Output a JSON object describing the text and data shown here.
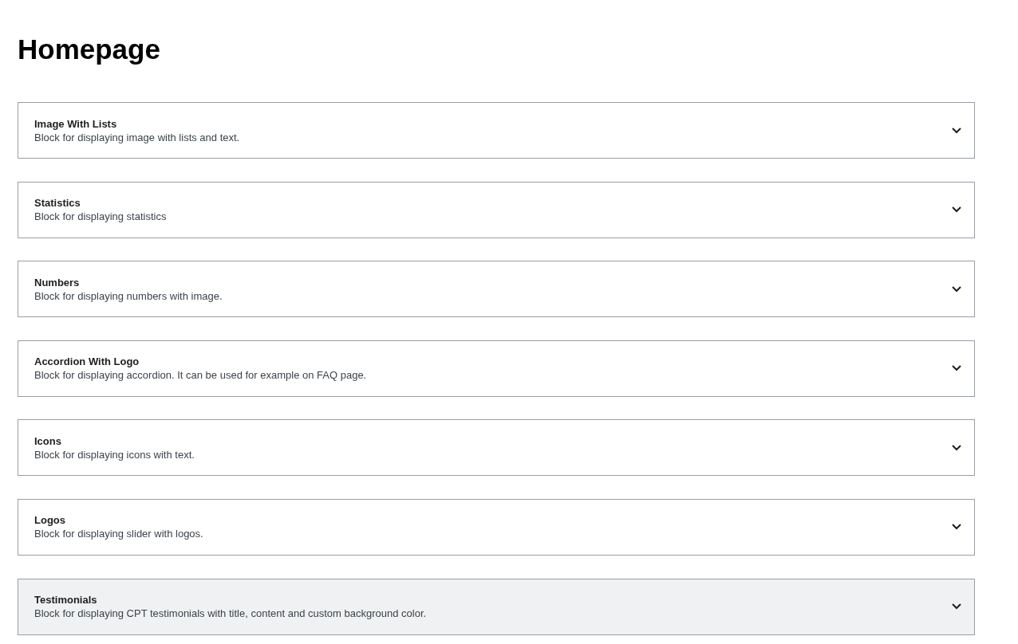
{
  "page": {
    "title": "Homepage"
  },
  "blocks": [
    {
      "title": "Image With Lists",
      "description": "Block for displaying image with lists and text.",
      "expanded": false,
      "hovered": false
    },
    {
      "title": "Statistics",
      "description": "Block for displaying statistics",
      "expanded": false,
      "hovered": false
    },
    {
      "title": "Numbers",
      "description": "Block for displaying numbers with image.",
      "expanded": false,
      "hovered": false
    },
    {
      "title": "Accordion With Logo",
      "description": "Block for displaying accordion. It can be used for example on FAQ page.",
      "expanded": false,
      "hovered": false
    },
    {
      "title": "Icons",
      "description": "Block for displaying icons with text.",
      "expanded": false,
      "hovered": false
    },
    {
      "title": "Logos",
      "description": "Block for displaying slider with logos.",
      "expanded": false,
      "hovered": false
    },
    {
      "title": "Testimonials",
      "description": "Block for displaying CPT testimonials with title, content and custom background color.",
      "expanded": false,
      "hovered": true
    }
  ]
}
